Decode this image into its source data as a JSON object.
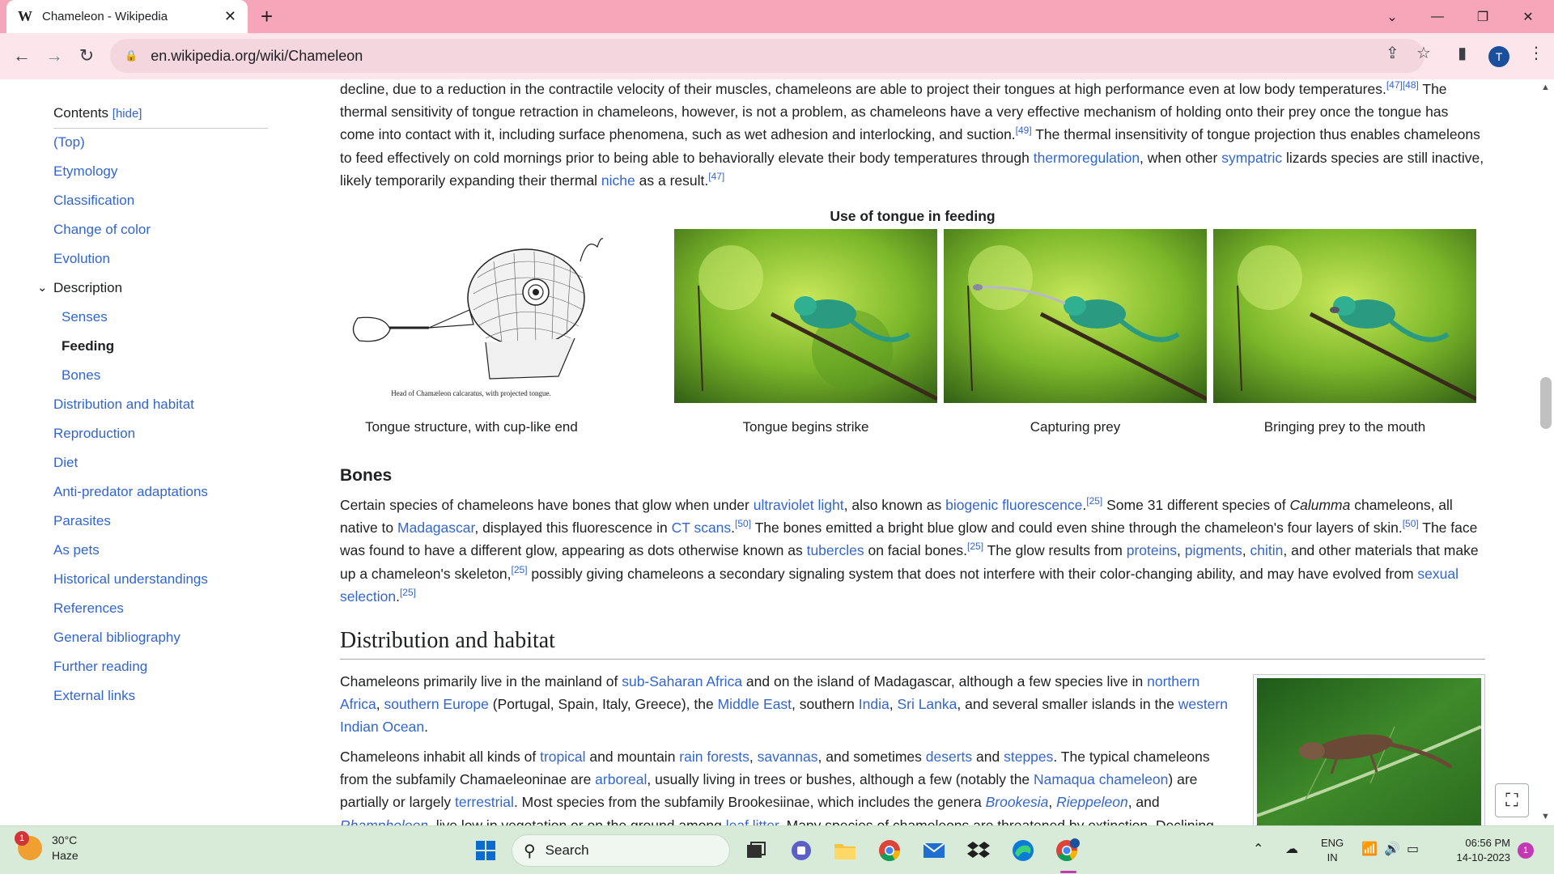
{
  "browser": {
    "tab_icon": "W",
    "tab_title": "Chameleon - Wikipedia",
    "tab_close": "✕",
    "new_tab": "+",
    "url": "en.wikipedia.org/wiki/Chameleon",
    "profile_initial": "T"
  },
  "toc": {
    "heading": "Contents",
    "hide_label": "[hide]",
    "items": {
      "top": "(Top)",
      "etymology": "Etymology",
      "classification": "Classification",
      "change_of_color": "Change of color",
      "evolution": "Evolution",
      "description": "Description",
      "senses": "Senses",
      "feeding": "Feeding",
      "bones": "Bones",
      "distribution": "Distribution and habitat",
      "reproduction": "Reproduction",
      "diet": "Diet",
      "anti_predator": "Anti-predator adaptations",
      "parasites": "Parasites",
      "as_pets": "As pets",
      "historical": "Historical understandings",
      "references": "References",
      "general_bibliography": "General bibliography",
      "further_reading": "Further reading",
      "external_links": "External links"
    }
  },
  "article": {
    "p1": {
      "t1": "decline, due to a reduction in the contractile velocity of their muscles, chameleons are able to project their tongues at high performance even at low body temperatures.",
      "ref1": "[47][48]",
      "t2": " The thermal sensitivity of tongue retraction in chameleons, however, is not a problem, as chameleons have a very effective mechanism of holding onto their prey once the tongue has come into contact with it, including surface phenomena, such as wet adhesion and interlocking, and suction.",
      "ref2": "[49]",
      "t3": " The thermal insensitivity of tongue projection thus enables chameleons to feed effectively on cold mornings prior to being able to behaviorally elevate their body temperatures through ",
      "link_thermoregulation": "thermoregulation",
      "t4": ", when other ",
      "link_sympatric": "sympatric",
      "t5": " lizards species are still inactive, likely temporarily expanding their thermal ",
      "link_niche": "niche",
      "t6": " as a result.",
      "ref3": "[47]"
    },
    "gallery": {
      "title": "Use of tongue in feeding",
      "drawing_caption": "Head of Chamæleon calcaratus, with projected tongue.",
      "captions": [
        "Tongue structure, with cup-like end",
        "Tongue begins strike",
        "Capturing prey",
        "Bringing prey to the mouth"
      ]
    },
    "bones": {
      "heading": "Bones",
      "t1": "Certain species of chameleons have bones that glow when under ",
      "link_uv": "ultraviolet light",
      "t2": ", also known as ",
      "link_biogenic": "biogenic fluorescence",
      "t3": ".",
      "ref_25a": "[25]",
      "t4": " Some 31 different species of ",
      "calumma": "Calumma",
      "t5": " chameleons, all native to ",
      "link_madagascar": "Madagascar",
      "t6": ", displayed this fluorescence in ",
      "link_ct": "CT scans",
      "t7": ".",
      "ref_50a": "[50]",
      "t8": " The bones emitted a bright blue glow and could even shine through the chameleon's four layers of skin.",
      "ref_50b": "[50]",
      "t9": " The face was found to have a different glow, appearing as dots otherwise known as ",
      "link_tubercles": "tubercles",
      "t10": " on facial bones.",
      "ref_25b": "[25]",
      "t11": " The glow results from ",
      "link_proteins": "proteins",
      "t12": ", ",
      "link_pigments": "pigments",
      "t13": ", ",
      "link_chitin": "chitin",
      "t14": ", and other materials that make up a chameleon's skeleton,",
      "ref_25c": "[25]",
      "t15": " possibly giving chameleons a secondary signaling system that does not interfere with their color-changing ability, and may have evolved from ",
      "link_sexual": "sexual selection",
      "t16": ".",
      "ref_25d": "[25]"
    },
    "distribution": {
      "heading": "Distribution and habitat",
      "p1": {
        "t1": "Chameleons primarily live in the mainland of ",
        "link_ssa": "sub-Saharan Africa",
        "t2": " and on the island of Madagascar, although a few species live in ",
        "link_north_africa": "northern Africa",
        "t3": ", ",
        "link_s_europe": "southern Europe",
        "t4": " (Portugal, Spain, Italy, Greece), the ",
        "link_mideast": "Middle East",
        "t5": ", southern ",
        "link_india": "India",
        "t6": ", ",
        "link_srilanka": "Sri Lanka",
        "t7": ", and several smaller islands in the ",
        "link_wio": "western Indian Ocean",
        "t8": "."
      },
      "p2": {
        "t1": "Chameleons inhabit all kinds of ",
        "link_tropical": "tropical",
        "t2": " and mountain ",
        "link_rainforests": "rain forests",
        "t3": ", ",
        "link_savannas": "savannas",
        "t4": ", and sometimes ",
        "link_deserts": "deserts",
        "t5": " and ",
        "link_steppes": "steppes",
        "t6": ". The typical chameleons from the subfamily Chamaeleoninae are ",
        "link_arboreal": "arboreal",
        "t7": ", usually living in trees or bushes, although a few (notably the ",
        "link_namaqua": "Namaqua chameleon",
        "t8": ") are partially or largely ",
        "link_terrestrial": "terrestrial",
        "t9": ". Most species from the subfamily Brookesiinae, which includes the genera ",
        "link_brookesia": "Brookesia",
        "t10": ", ",
        "link_rieppeleon": "Rieppeleon",
        "t11": ", and ",
        "link_rhampholeon": "Rhampholeon",
        "t12": ", live low in vegetation or on the ground among ",
        "link_leaflitter": "leaf litter",
        "t13": ". Many species of chameleons are threatened by extinction. Declining"
      }
    }
  },
  "taskbar": {
    "weather_badge": "1",
    "temperature": "30°C",
    "condition": "Haze",
    "search_placeholder": "Search",
    "chrome_badge": "T",
    "lang_top": "ENG",
    "lang_bottom": "IN",
    "time": "06:56 PM",
    "date": "14-10-2023",
    "notification_count": "1"
  },
  "icons": [
    "wikipedia-icon",
    "close-icon",
    "plus-icon",
    "chevron-down-icon",
    "minimize-icon",
    "restore-icon",
    "back-icon",
    "forward-icon",
    "reload-icon",
    "lock-icon",
    "share-icon",
    "star-icon",
    "sidepanel-icon",
    "kebab-icon",
    "fullscreen-icon",
    "windows-start-icon",
    "search-icon",
    "task-view-icon",
    "teams-icon",
    "file-explorer-icon",
    "chrome-icon",
    "mail-icon",
    "dropbox-icon",
    "edge-icon",
    "wifi-icon",
    "volume-icon",
    "battery-icon",
    "onedrive-icon"
  ],
  "colors": {
    "link": "#3366cc",
    "tabbar": "#f6a6b8",
    "toolbar": "#fce6ec",
    "taskbar": "#d8ead8"
  }
}
